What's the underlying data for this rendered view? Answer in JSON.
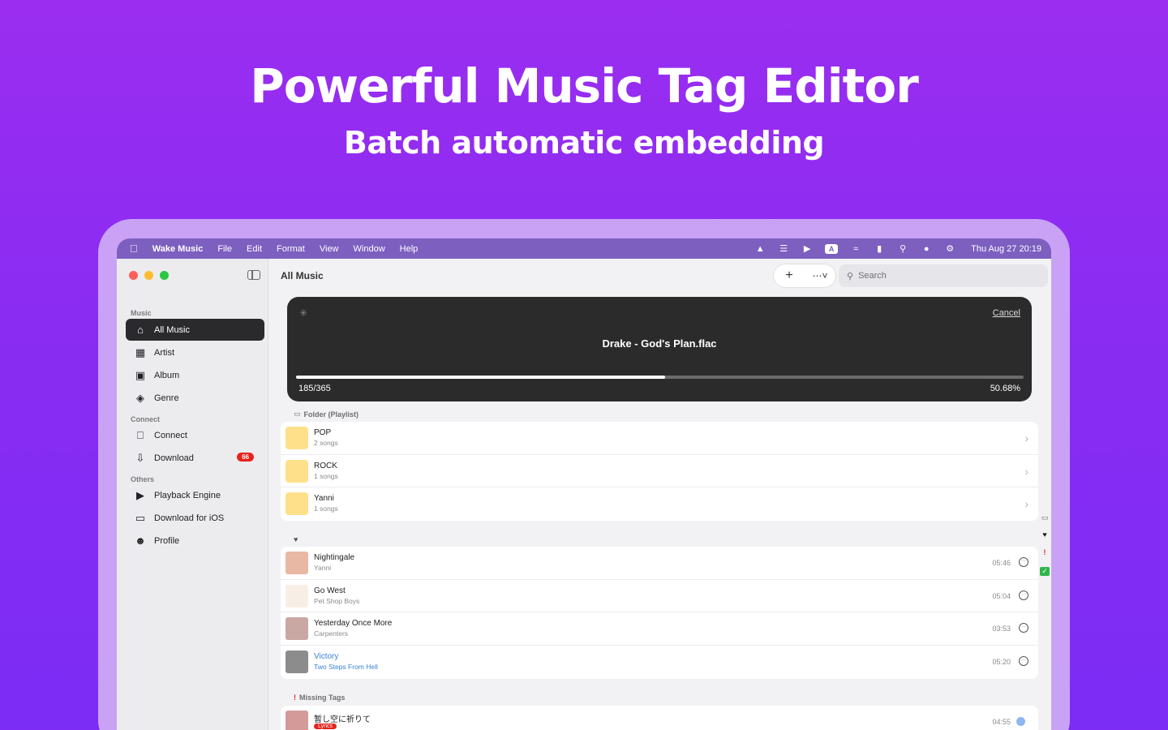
{
  "hero": {
    "title": "Powerful Music Tag Editor",
    "subtitle": "Batch automatic embedding"
  },
  "menubar": {
    "app_name": "Wake Music",
    "menus": [
      "File",
      "Edit",
      "Format",
      "View",
      "Window",
      "Help"
    ],
    "input_indicator": "A",
    "clock": "Thu Aug 27  20:19"
  },
  "sidebar": {
    "sections": {
      "music": "Music",
      "connect": "Connect",
      "others": "Others"
    },
    "items": [
      {
        "label": "All Music",
        "icon": "home-icon"
      },
      {
        "label": "Artist",
        "icon": "artist-icon"
      },
      {
        "label": "Album",
        "icon": "album-icon"
      },
      {
        "label": "Genre",
        "icon": "genre-icon"
      },
      {
        "label": "Connect",
        "icon": "connect-icon"
      },
      {
        "label": "Download",
        "icon": "download-icon",
        "badge": "66"
      },
      {
        "label": "Playback Engine",
        "icon": "playback-icon"
      },
      {
        "label": "Download for iOS",
        "icon": "ios-icon"
      },
      {
        "label": "Profile",
        "icon": "profile-icon"
      }
    ]
  },
  "main": {
    "title": "All Music",
    "search_placeholder": "Search",
    "progress": {
      "cancel_label": "Cancel",
      "file_name": "Drake  - God's Plan.flac",
      "count": "185/365",
      "percent": "50.68%",
      "fraction": 0.5068
    },
    "folders_label": "Folder (Playlist)",
    "folders": [
      {
        "name": "POP",
        "count": "2 songs"
      },
      {
        "name": "ROCK",
        "count": "1 songs"
      },
      {
        "name": "Yanni",
        "count": "1 songs"
      }
    ],
    "favorites_icon": "heart-icon",
    "songs": [
      {
        "title": "Nightingale",
        "artist": "Yanni",
        "duration": "05:46",
        "thumb_color": "#e9b8a4"
      },
      {
        "title": "Go West",
        "artist": "Pet Shop Boys",
        "duration": "05:04",
        "thumb_color": "#f7efe6"
      },
      {
        "title": "Yesterday Once More",
        "artist": "Carpenters",
        "duration": "03:53",
        "thumb_color": "#c9a7a3"
      },
      {
        "title": "Victory",
        "artist": "Two Steps From Hell",
        "duration": "05:20",
        "thumb_color": "#8c8c8c"
      }
    ],
    "missing_label": "Missing Tags",
    "missing": [
      {
        "title": "暂し空に祈りて",
        "badge": "Lyrics",
        "duration": "04:55",
        "thumb_color": "#d49a9a"
      }
    ]
  },
  "colors": {
    "background": "#8a2cf2",
    "accent_red": "#e8221b",
    "link_blue": "#3a82d8"
  }
}
